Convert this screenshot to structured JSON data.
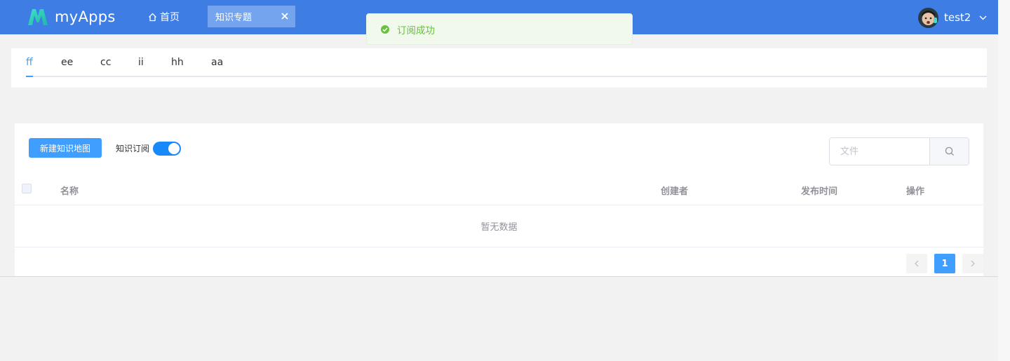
{
  "header": {
    "app_name": "myApps",
    "home_label": "首页",
    "open_tab_label": "知识专题",
    "user_name": "test2"
  },
  "toast": {
    "message": "订阅成功"
  },
  "category_tabs": [
    {
      "label": "ff",
      "active": true
    },
    {
      "label": "ee",
      "active": false
    },
    {
      "label": "cc",
      "active": false
    },
    {
      "label": "ii",
      "active": false
    },
    {
      "label": "hh",
      "active": false
    },
    {
      "label": "aa",
      "active": false
    }
  ],
  "toolbar": {
    "new_button_label": "新建知识地图",
    "subscribe_label": "知识订阅",
    "subscribe_on": true,
    "search_placeholder": "文件"
  },
  "table": {
    "columns": [
      "名称",
      "创建者",
      "发布时间",
      "操作"
    ],
    "empty_text": "暂无数据"
  },
  "pagination": {
    "current_page": "1"
  },
  "colors": {
    "header_bg": "#3d7de4",
    "primary": "#409eff",
    "success": "#67c23a"
  }
}
